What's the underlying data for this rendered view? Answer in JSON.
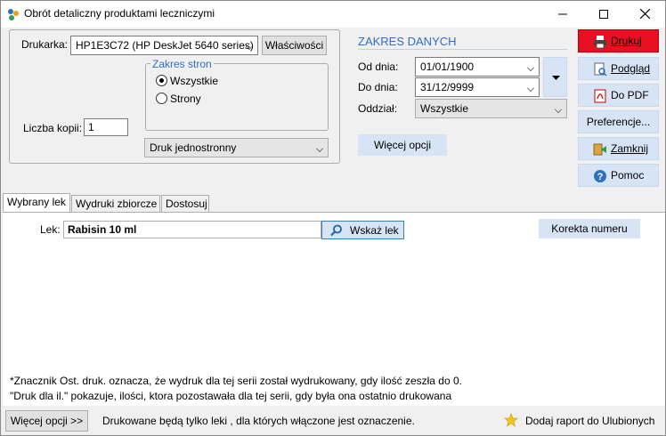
{
  "window": {
    "title": "Obrót detaliczny produktami leczniczymi"
  },
  "printer": {
    "label": "Drukarka:",
    "value": "HP1E3C72 (HP DeskJet 5640 series)",
    "properties_button": "Właściwości",
    "page_range": {
      "title": "Zakres stron",
      "options": [
        "Wszystkie",
        "Strony"
      ],
      "selected": "Wszystkie"
    },
    "copies_label": "Liczba kopii:",
    "copies_value": "1",
    "duplex_value": "Druk jednostronny"
  },
  "date_range": {
    "title": "ZAKRES DANYCH",
    "from_label": "Od dnia:",
    "from_value": "01/01/1900",
    "to_label": "Do dnia:",
    "to_value": "31/12/9999",
    "department_label": "Oddział:",
    "department_value": "Wszystkie",
    "more_options": "Więcej opcji"
  },
  "side_buttons": {
    "print": "Drukuj",
    "preview": "Podgląd",
    "pdf": "Do PDF",
    "preferences": "Preferencje...",
    "close": "Zamknij",
    "help": "Pomoc"
  },
  "tabs": [
    "Wybrany lek",
    "Wydruki zbiorcze",
    "Dostosuj"
  ],
  "drug": {
    "label": "Lek:",
    "value": "Rabisin 10 ml",
    "choose_button": "Wskaż lek",
    "correction_button": "Korekta numeru"
  },
  "notes": [
    "*Znacznik Ost. druk. oznacza, że wydruk dla tej serii został wydrukowany, gdy ilość zeszła do 0.",
    "\"Druk dla il.\" pokazuje, ilości, ktora pozostawała dla tej serii, gdy była ona ostatnio drukowana"
  ],
  "footer": {
    "more_options": "Więcej opcji >>",
    "info": "Drukowane będą tylko leki , dla których  włączone jest oznaczenie.",
    "favorites": "Dodaj raport do Ulubionych"
  }
}
